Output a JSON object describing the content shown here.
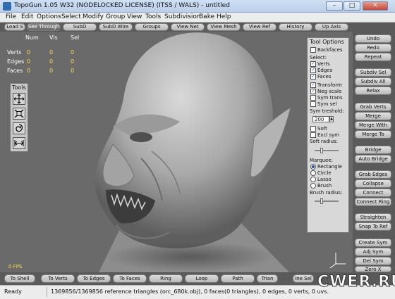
{
  "window": {
    "title": "TopoGun 1.05 W32  (NODELOCKED LICENSE) (ITSS / WALS) - untitled",
    "minimize": "–",
    "maximize": "□",
    "close": "✕"
  },
  "menu": [
    "File",
    "Edit",
    "Options",
    "Select",
    "Modify",
    "Group",
    "View",
    "Tools",
    "Subdivision",
    "Bake",
    "Help"
  ],
  "toolbar": [
    {
      "label": "Load S",
      "active": false
    },
    {
      "label": "See Through",
      "active": true
    },
    {
      "label": "SubD",
      "active": false
    },
    {
      "label": "SubD Wire",
      "active": false
    },
    {
      "label": "Groups",
      "active": false
    },
    {
      "label": "View Net",
      "active": false
    },
    {
      "label": "View Mesh",
      "active": false
    },
    {
      "label": "View Ref",
      "active": false
    },
    {
      "label": "History",
      "active": false
    },
    {
      "label": "Up Axis",
      "active": false
    }
  ],
  "stats": {
    "headers": [
      "Num",
      "Vis",
      "Sel"
    ],
    "rows": [
      {
        "label": "Verts",
        "values": [
          "0",
          "0",
          "0"
        ]
      },
      {
        "label": "Edges",
        "values": [
          "0",
          "0",
          "0"
        ]
      },
      {
        "label": "Faces",
        "values": [
          "0",
          "0",
          "0"
        ]
      }
    ]
  },
  "tools": {
    "title": "Tools",
    "icons": [
      "move-tool-icon",
      "scale-tool-icon",
      "lasso-tool-icon",
      "measure-tool-icon"
    ]
  },
  "fps": "0 FPS",
  "tool_options": {
    "title": "Tool Options",
    "backfaces": {
      "label": "Backfaces",
      "checked": false
    },
    "select_label": "Select:",
    "select": [
      {
        "label": "Verts",
        "checked": true
      },
      {
        "label": "Edges",
        "checked": true
      },
      {
        "label": "Faces",
        "checked": true
      }
    ],
    "options": [
      {
        "label": "Transform",
        "checked": true
      },
      {
        "label": "Neg scale",
        "checked": true
      },
      {
        "label": "Sym trans",
        "checked": false
      },
      {
        "label": "Sym sel",
        "checked": false
      }
    ],
    "sym_threshold_label": "Sym treshold:",
    "sym_threshold_value": "200",
    "soft": {
      "label": "Soft",
      "checked": false
    },
    "excl_sym": {
      "label": "Excl sym",
      "checked": false
    },
    "soft_radius_label": "Soft radius:",
    "marquee_label": "Marquee:",
    "marquee": [
      {
        "label": "Rectangle",
        "selected": true
      },
      {
        "label": "Circle",
        "selected": false
      },
      {
        "label": "Lasso",
        "selected": false
      },
      {
        "label": "Brush",
        "selected": false
      }
    ],
    "brush_radius_label": "Brush radius:"
  },
  "right_buttons": [
    "Undo",
    "Redo",
    "Repeat",
    "Subdiv Sel",
    "Subdiv All",
    "Relax",
    "Grab Verts",
    "Merge",
    "Merge With",
    "Merge To",
    "Bridge",
    "Auto Bridge",
    "Grab Edges",
    "Collapse",
    "Connect",
    "Connect Ring",
    "Straighten",
    "Snap To Ref",
    "Create Sym",
    "Adj Sym",
    "Del Sym",
    "Zero X"
  ],
  "bottom_buttons": [
    "To Shell",
    "To Verts",
    "To Edges",
    "To Faces",
    "Ring",
    "Loop",
    "Path",
    "Trian",
    "Ine Sel"
  ],
  "status": {
    "ready": "Ready",
    "info": "1369856/1369856 reference triangles (orc_680k.obj), 0 faces(0 triangles), 0 edges, 0 verts, 0 uvs."
  },
  "watermark": "CWER.RU",
  "colors": {
    "viewport_bg": "#6a6a6a",
    "stat_values": "#ffd84a",
    "panel_bg": "#5a5a5a"
  }
}
